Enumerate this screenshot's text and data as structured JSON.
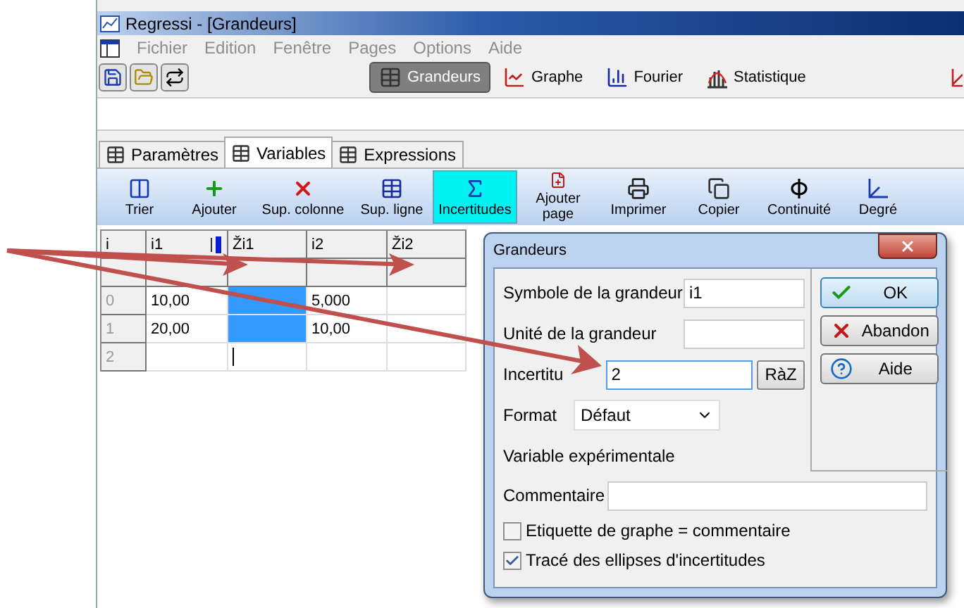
{
  "window": {
    "title": "Regressi - [Grandeurs]"
  },
  "menu": [
    {
      "label": "Fichier",
      "disabled": true
    },
    {
      "label": "Edition",
      "disabled": true
    },
    {
      "label": "Fenêtre",
      "disabled": true
    },
    {
      "label": "Pages",
      "disabled": true
    },
    {
      "label": "Options",
      "disabled": true
    },
    {
      "label": "Aide",
      "disabled": true
    }
  ],
  "views": [
    {
      "label": "Grandeurs",
      "selected": true
    },
    {
      "label": "Graphe",
      "selected": false
    },
    {
      "label": "Fourier",
      "selected": false
    },
    {
      "label": "Statistique",
      "selected": false
    }
  ],
  "tabs": [
    {
      "label": "Paramètres",
      "selected": false
    },
    {
      "label": "Variables",
      "selected": true
    },
    {
      "label": "Expressions",
      "selected": false
    }
  ],
  "actions": [
    {
      "label": "Trier",
      "selected": false
    },
    {
      "label": "Ajouter",
      "selected": false
    },
    {
      "label": "Sup. colonne",
      "selected": false
    },
    {
      "label": "Sup. ligne",
      "selected": false
    },
    {
      "label": "Incertitudes",
      "selected": true
    },
    {
      "label": "Ajouter page",
      "selected": false
    },
    {
      "label": "Imprimer",
      "selected": false
    },
    {
      "label": "Copier",
      "selected": false
    },
    {
      "label": "Continuité",
      "selected": false
    },
    {
      "label": "Degré",
      "selected": false
    }
  ],
  "grid": {
    "columns": [
      "i",
      "i1",
      "Ži1",
      "i2",
      "Ži2"
    ],
    "rows": [
      {
        "index": "0",
        "cells": [
          {
            "text": "10,00",
            "selected": false
          },
          {
            "selected": true
          },
          {
            "text": "5,000",
            "selected": false
          },
          {
            "selected": false
          }
        ]
      },
      {
        "index": "1",
        "cells": [
          {
            "text": "20,00",
            "selected": false
          },
          {
            "selected": true
          },
          {
            "text": "10,00",
            "selected": false
          },
          {
            "selected": false
          }
        ]
      },
      {
        "index": "2",
        "cells": [
          {
            "selected": false
          },
          {
            "selected": false,
            "editing": true
          },
          {
            "selected": false
          },
          {
            "selected": false
          }
        ]
      }
    ]
  },
  "dialog": {
    "title": "Grandeurs",
    "fields": [
      {
        "kind": "text",
        "label": "Symbole de la grandeur",
        "value": "i1"
      },
      {
        "kind": "text",
        "label": "Unité de la grandeur"
      },
      {
        "kind": "reset",
        "label": "Incertitu",
        "value": "2",
        "button": "RàZ"
      },
      {
        "kind": "select",
        "label": "Format",
        "value": "Défaut"
      },
      {
        "kind": "heading",
        "label": "Variable expérimentale"
      },
      {
        "kind": "wide",
        "label": "Commentaire"
      }
    ],
    "checkboxes": [
      {
        "label": "Etiquette de graphe = commentaire",
        "checked": false
      },
      {
        "label": "Tracé des ellipses d'incertitudes",
        "checked": true
      }
    ],
    "buttons": [
      {
        "kind": "ok",
        "label": "OK"
      },
      {
        "kind": "cancel",
        "label": "Abandon"
      },
      {
        "kind": "help",
        "label": "Aide"
      }
    ]
  }
}
